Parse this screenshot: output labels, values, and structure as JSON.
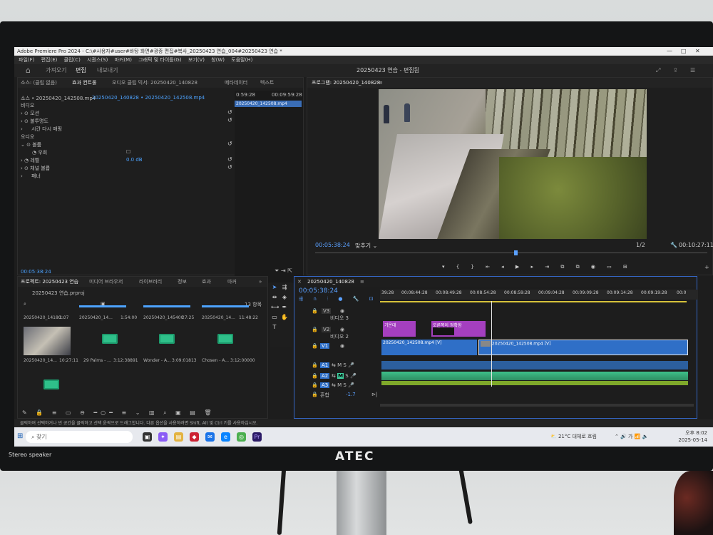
{
  "monitor": {
    "brand": "ATEC",
    "speaker_label": "Stereo speaker"
  },
  "app": {
    "title": "Adobe Premiere Pro 2024 - C:\\#사용자#user#바탕 화면#광종 편집#복사_20250423 연습_004#20250423 연습 *",
    "menu": [
      "파일(F)",
      "편집(E)",
      "클립(C)",
      "시퀀스(S)",
      "마커(M)",
      "그래픽 및 타이틀(G)",
      "보기(V)",
      "창(W)",
      "도움말(H)"
    ],
    "workspaces": [
      "가져오기",
      "편집",
      "내보내기"
    ],
    "active_workspace": "편집",
    "sequence_title": "20250423 연습 - 편집됨"
  },
  "source_panel": {
    "tabs": [
      "소스: (클립 없음)",
      "효과 컨트롤",
      "오디오 클립 믹서: 20250420_140828",
      "메타데이터",
      "텍스트"
    ],
    "clip_path": "소스 • 20250420_142508.mp4",
    "sequence_path": "20250420_140828 • 20250420_142508.mp4",
    "time_start": "0:59:28",
    "time_end": "00:09:59:28",
    "mini_clip_label": "20250420_142508.mp4",
    "rows": [
      {
        "label": "비디오",
        "indent": 0
      },
      {
        "label": "모션",
        "indent": 1
      },
      {
        "label": "불투명도",
        "indent": 1
      },
      {
        "label": "시간 다시 매핑",
        "indent": 1
      },
      {
        "label": "오디오",
        "indent": 0
      },
      {
        "label": "볼륨",
        "indent": 1
      },
      {
        "label": "우회",
        "indent": 2
      },
      {
        "label": "레벨",
        "indent": 2
      },
      {
        "label": "채널 볼륨",
        "indent": 1
      },
      {
        "label": "패너",
        "indent": 1
      }
    ],
    "level_value": "0.0 dB",
    "footer_time": "00:05:38:24"
  },
  "program_monitor": {
    "title": "프로그램: 20250420_140828",
    "timecode": "00:05:38:24",
    "fit": "맞추기",
    "quality": "1/2",
    "duration": "00:10:27:11"
  },
  "project_panel": {
    "tabs": [
      "프로젝트: 20250423 연습",
      "미디어 브라우저",
      "라이브러리",
      "정보",
      "효과",
      "마커"
    ],
    "project_file": "20250423 연습.prproj",
    "item_count": "13 항목",
    "items": [
      {
        "name": "20250420_14180...",
        "duration": "2:07",
        "kind": "video"
      },
      {
        "name": "20250420_14...",
        "duration": "1:54:00",
        "kind": "video"
      },
      {
        "name": "20250420_145400",
        "duration": "27:25",
        "kind": "video"
      },
      {
        "name": "20250420_14...",
        "duration": "11:48:22",
        "kind": "video"
      },
      {
        "name": "20250420_14...",
        "duration": "10:27:11",
        "kind": "video"
      },
      {
        "name": "29 Palms - ...",
        "duration": "3:12:38891",
        "kind": "audio"
      },
      {
        "name": "Wonder - A...",
        "duration": "3:09:01813",
        "kind": "audio"
      },
      {
        "name": "Chosen - A...",
        "duration": "3:12:00000",
        "kind": "audio"
      },
      {
        "name": "",
        "duration": "",
        "kind": "audio"
      }
    ]
  },
  "timeline": {
    "sequence_tab": "20250420_140828",
    "timecode": "00:05:38:24",
    "ruler": [
      "39:28",
      "00:08:44:28",
      "00:08:49:28",
      "00:08:54:28",
      "00:08:59:28",
      "00:09:04:28",
      "00:09:09:28",
      "00:09:14:28",
      "00:09:19:28",
      "00:0"
    ],
    "tracks": [
      {
        "id": "V3",
        "name": "비디오 3"
      },
      {
        "id": "V2",
        "name": "비디오 2"
      },
      {
        "id": "V1",
        "name": ""
      },
      {
        "id": "A1",
        "name": ""
      },
      {
        "id": "A2",
        "name": ""
      },
      {
        "id": "A3",
        "name": ""
      }
    ],
    "mix_label": "혼합",
    "mix_value": "-1.7",
    "clips": {
      "v2_a": "기온대",
      "v2_b": "오른쪽이 정확함",
      "v1_a": "20250420_142508.mp4 [V]",
      "v1_b": "20250420_142508.mp4 [V]"
    }
  },
  "status_bar": "클릭하여 선택하거나 빈 공간을 클릭하고 선택 윤곽으로 드래그합니다. 다른 옵션을 사용하려면 Shift, Alt 및 Ctrl 키를 사용하십시오.",
  "taskbar": {
    "search_placeholder": "찾기",
    "weather": "21°C 대체로 흐림",
    "time": "오후 8:02",
    "date": "2025-05-14",
    "lang": "가"
  }
}
